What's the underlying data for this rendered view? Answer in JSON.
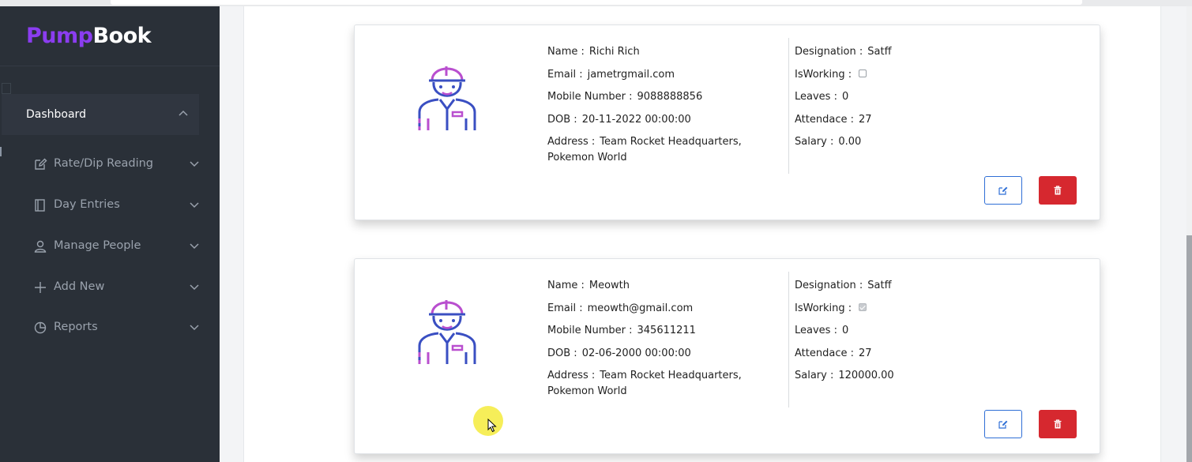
{
  "app": {
    "logo_part1": "Pump",
    "logo_part2": "Book",
    "brand_color": "#8b3df0"
  },
  "sidebar": {
    "dashboard_label": "Dashboard",
    "items": [
      {
        "label": "Rate/Dip Reading",
        "icon": "edit-icon"
      },
      {
        "label": "Day Entries",
        "icon": "book-icon"
      },
      {
        "label": "Manage People",
        "icon": "user-icon"
      },
      {
        "label": "Add New",
        "icon": "plus-icon"
      },
      {
        "label": "Reports",
        "icon": "pie-chart-icon"
      }
    ]
  },
  "labels": {
    "name": "Name :",
    "email": "Email :",
    "mobile": "Mobile Number :",
    "dob": "DOB :",
    "address": "Address :",
    "designation": "Designation :",
    "isworking": "IsWorking :",
    "leaves": "Leaves :",
    "attendance": "Attendace :",
    "salary": "Salary :"
  },
  "employees": [
    {
      "name": "Richi Rich",
      "email": "jametrgmail.com",
      "mobile": "9088888856",
      "dob": "20-11-2022 00:00:00",
      "address": "Team Rocket Headquarters, Pokemon World",
      "designation": "Satff",
      "is_working": false,
      "leaves": "0",
      "attendance": "27",
      "salary": "0.00"
    },
    {
      "name": "Meowth",
      "email": "meowth@gmail.com",
      "mobile": "345611211",
      "dob": "02-06-2000 00:00:00",
      "address": "Team Rocket Headquarters, Pokemon World",
      "designation": "Satff",
      "is_working": true,
      "leaves": "0",
      "attendance": "27",
      "salary": "120000.00"
    }
  ],
  "colors": {
    "sidebar_bg": "#2a3038",
    "edit_button": "#2f6fd6",
    "delete_button": "#d6282f"
  }
}
